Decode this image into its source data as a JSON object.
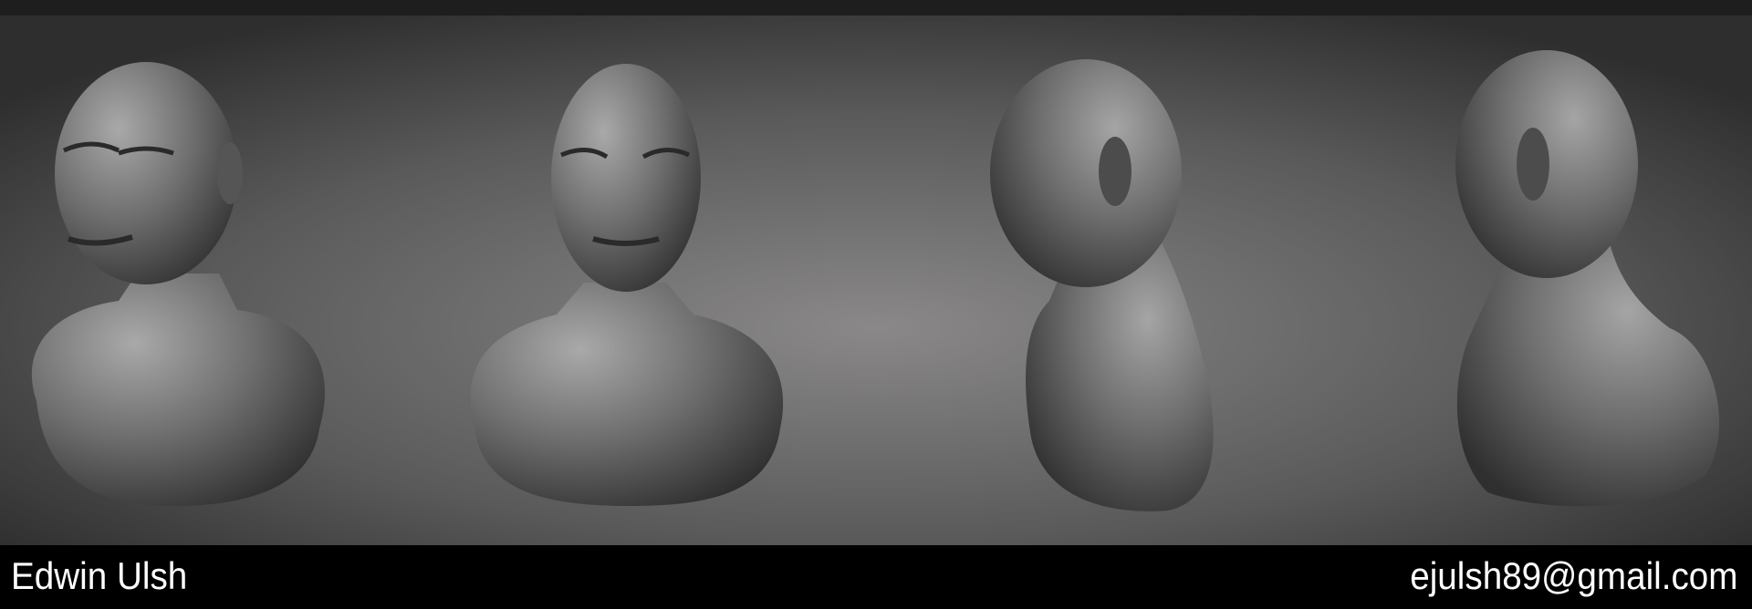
{
  "footer": {
    "artist_name": "Edwin Ulsh",
    "email": "ejulsh89@gmail.com"
  },
  "render": {
    "views": [
      "three-quarter",
      "front",
      "side-profile",
      "back"
    ],
    "background_center": "#8a8888",
    "background_edge": "#2e2e2e",
    "top_strip": "#1e1e1e"
  }
}
